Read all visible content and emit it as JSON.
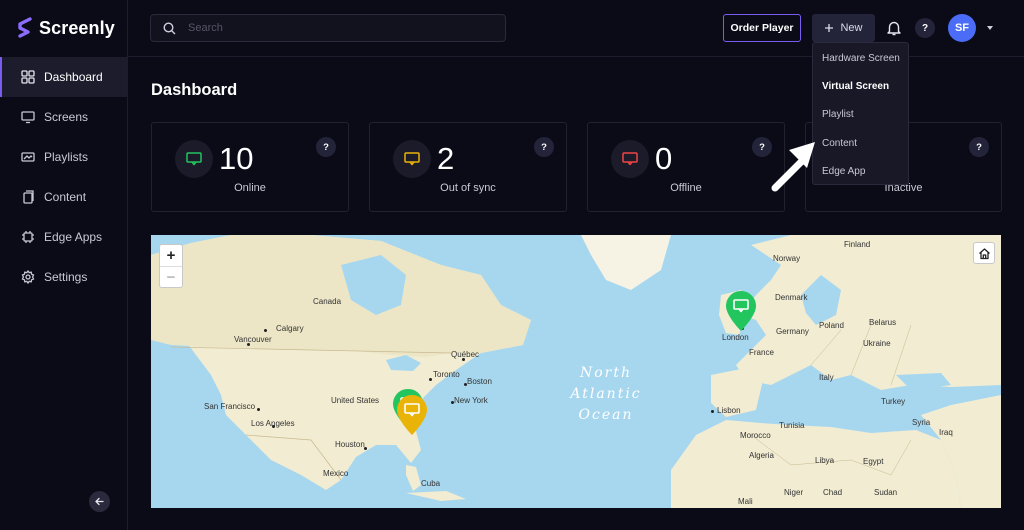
{
  "brand": {
    "name": "Screenly"
  },
  "sidebar": {
    "items": [
      {
        "label": "Dashboard",
        "icon": "dashboard-icon"
      },
      {
        "label": "Screens",
        "icon": "monitor-icon"
      },
      {
        "label": "Playlists",
        "icon": "playlist-icon"
      },
      {
        "label": "Content",
        "icon": "content-icon"
      },
      {
        "label": "Edge Apps",
        "icon": "edge-apps-icon"
      },
      {
        "label": "Settings",
        "icon": "gear-icon"
      }
    ],
    "collapse_icon": "arrow-left-icon"
  },
  "topbar": {
    "search_placeholder": "Search",
    "order_player_label": "Order Player",
    "new_label": "New",
    "help_label": "?",
    "avatar_initials": "SF"
  },
  "new_menu": {
    "items": [
      "Hardware Screen",
      "Virtual Screen",
      "Playlist",
      "Content",
      "Edge App"
    ]
  },
  "main": {
    "title": "Dashboard",
    "cards": [
      {
        "value": "10",
        "label": "Online",
        "color": "#22c55e"
      },
      {
        "value": "2",
        "label": "Out of sync",
        "color": "#eab308"
      },
      {
        "value": "0",
        "label": "Offline",
        "color": "#ef4444"
      },
      {
        "value": "",
        "label": "Inactive",
        "color": "#9ca3af"
      }
    ],
    "card_help": "?"
  },
  "map": {
    "zoom_in": "+",
    "zoom_out": "−",
    "ocean": [
      "North",
      "Atlantic",
      "Ocean"
    ],
    "labels": {
      "canada": "Canada",
      "calgary": "Calgary",
      "vancouver": "Vancouver",
      "quebec": "Québec",
      "toronto": "Toronto",
      "boston": "Boston",
      "new_york": "New York",
      "united_states": "United States",
      "san_francisco": "San Francisco",
      "los_angeles": "Los Angeles",
      "houston": "Houston",
      "mexico": "Mexico",
      "cuba": "Cuba",
      "finland": "Finland",
      "norway": "Norway",
      "denmark": "Denmark",
      "london": "London",
      "germany": "Germany",
      "poland": "Poland",
      "belarus": "Belarus",
      "ukraine": "Ukraine",
      "france": "France",
      "italy": "Italy",
      "turkey": "Turkey",
      "lisbon": "Lisbon",
      "tunisia": "Tunisia",
      "morocco": "Morocco",
      "algeria": "Algeria",
      "libya": "Libya",
      "egypt": "Egypt",
      "mali": "Mali",
      "niger": "Niger",
      "chad": "Chad",
      "sudan": "Sudan",
      "syria": "Syria",
      "iraq": "Iraq"
    }
  },
  "colors": {
    "accent": "#7b5cf0",
    "online": "#22c55e",
    "out_of_sync": "#eab308",
    "offline": "#ef4444"
  }
}
